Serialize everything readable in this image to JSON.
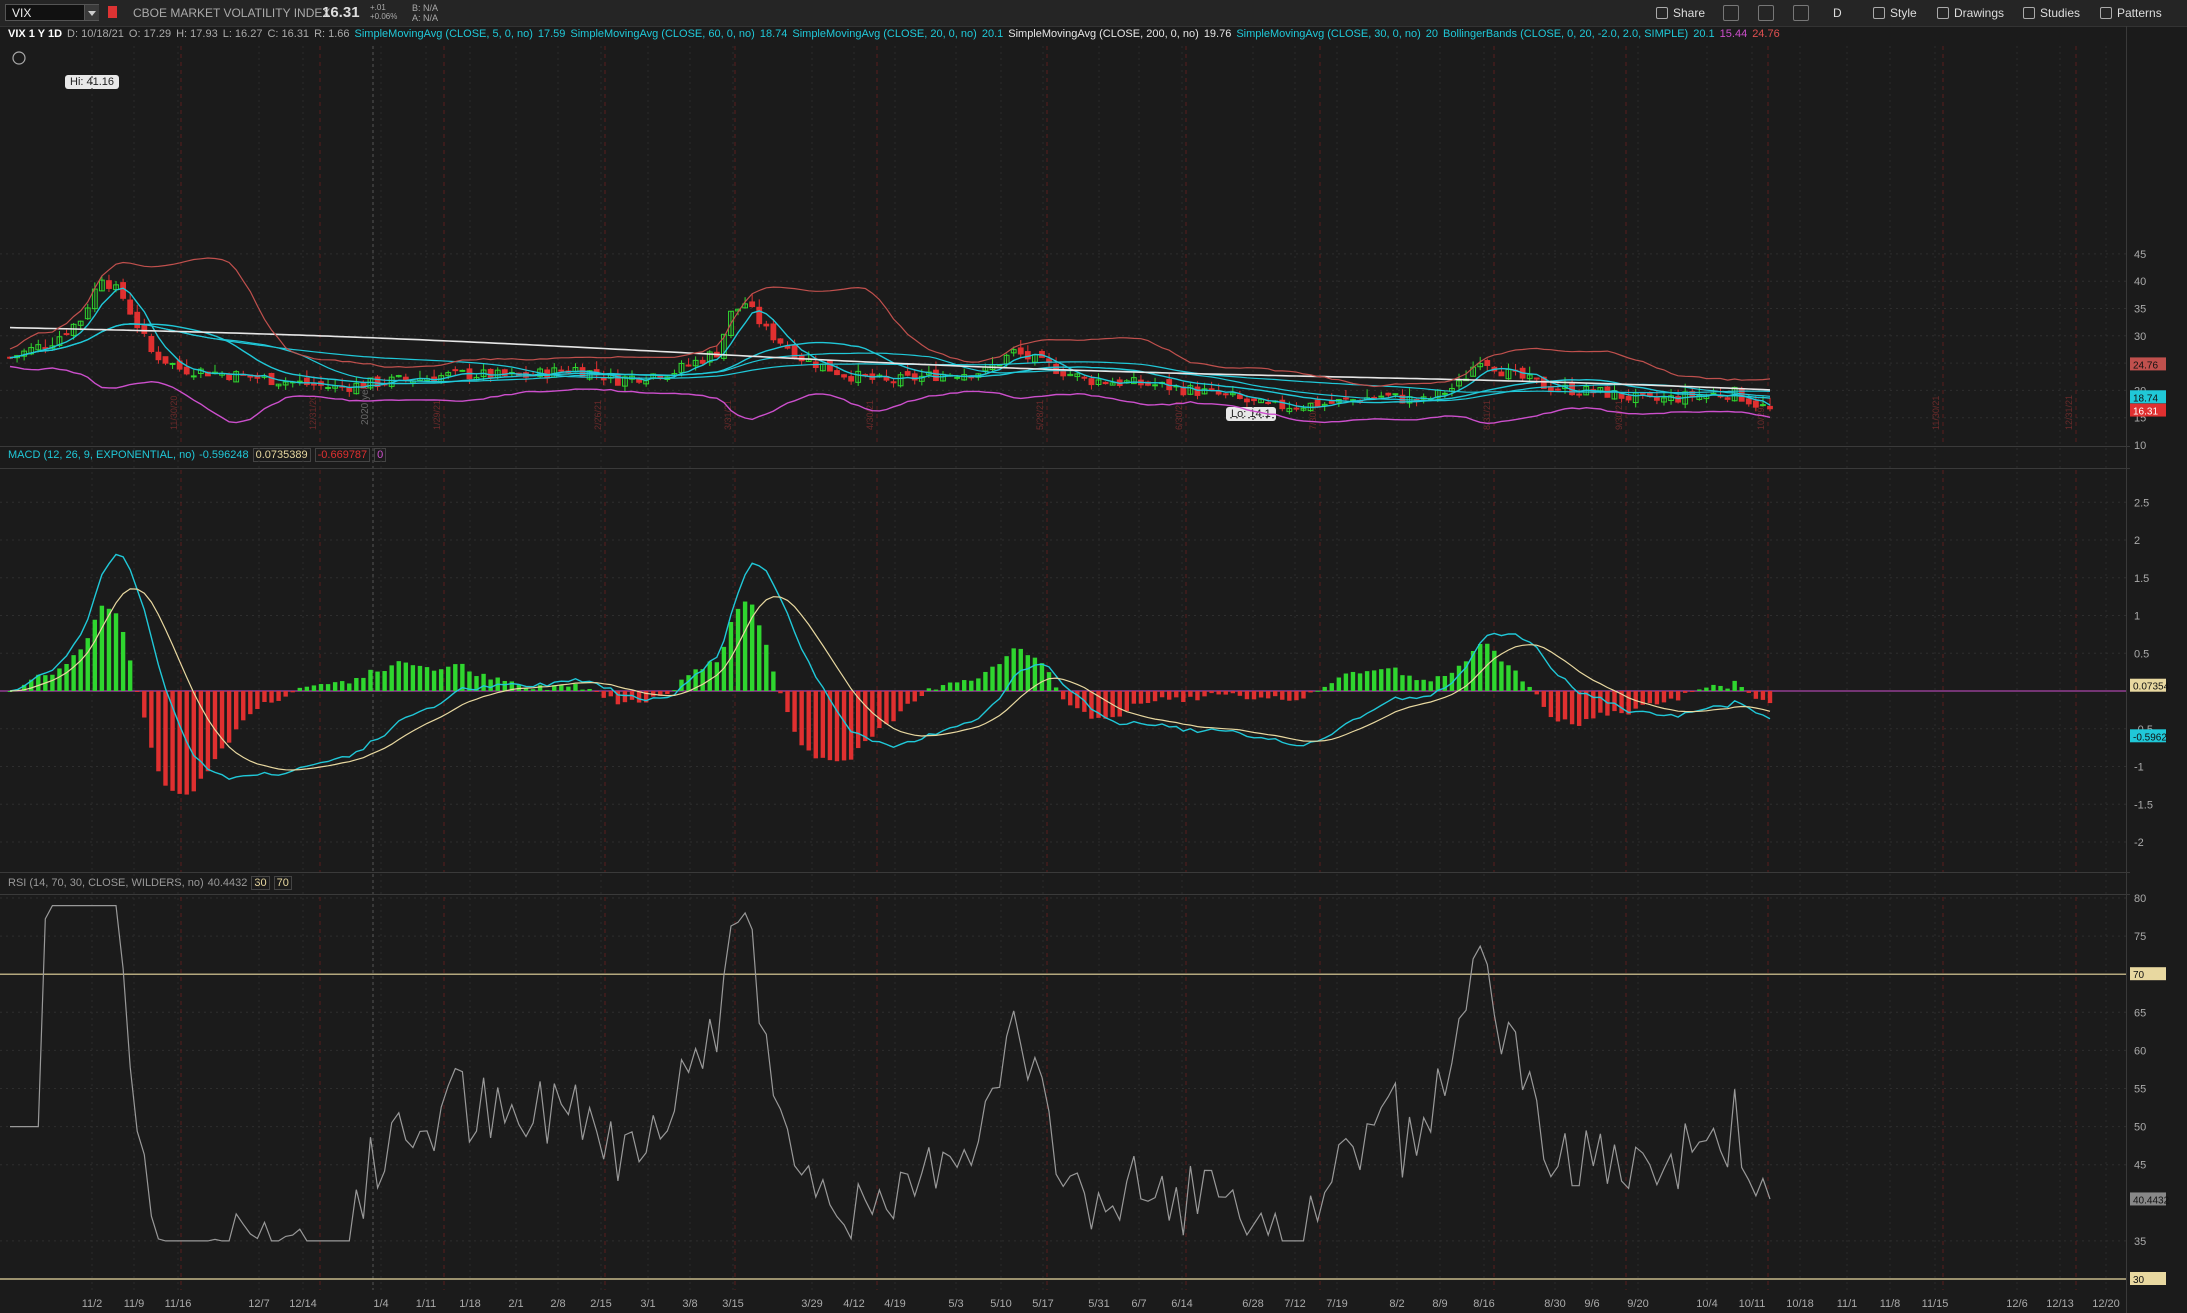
{
  "toolbar": {
    "symbol": "VIX",
    "name": "CBOE MARKET VOLATILITY INDEX",
    "last": "16.31",
    "change": "+.01",
    "change_pct": "+0.06%",
    "bid": "B: N/A",
    "ask": "A: N/A",
    "share": "Share",
    "period": "D",
    "style": "Style",
    "drawings": "Drawings",
    "studies": "Studies",
    "patterns": "Patterns"
  },
  "studybar": {
    "chart_label": "VIX 1 Y 1D",
    "date": "D: 10/18/21",
    "open": "O: 17.29",
    "high": "H: 17.93",
    "low": "L: 16.27",
    "close": "C: 16.31",
    "range": "R: 1.66",
    "sma5": "SimpleMovingAvg (CLOSE, 5, 0, no)",
    "sma5_v": "17.59",
    "sma60": "SimpleMovingAvg (CLOSE, 60, 0, no)",
    "sma60_v": "18.74",
    "sma20": "SimpleMovingAvg (CLOSE, 20, 0, no)",
    "sma20_v": "20.1",
    "sma200": "SimpleMovingAvg (CLOSE, 200, 0, no)",
    "sma200_v": "19.76",
    "sma30": "SimpleMovingAvg (CLOSE, 30, 0, no)",
    "sma30_v": "20",
    "bb": "BollingerBands (CLOSE, 0, 20, -2.0, 2.0, SIMPLE)",
    "bb_mid": "20.1",
    "bb_low": "15.44",
    "bb_up": "24.76"
  },
  "price_pane": {
    "hi_label": "Hi: 41.16",
    "lo_label": "Lo: 14.1",
    "year_label": "2020 year",
    "axis_ticks": [
      "45",
      "40",
      "35",
      "30",
      "25",
      "20",
      "15",
      "10"
    ],
    "tag_up": "24.76",
    "tag_mid": "18.74",
    "tag_last": "16.31",
    "vertical_dates": [
      "11/30/20",
      "12/31/20",
      "1/29/21",
      "2/26/21",
      "3/31/21",
      "4/30/21",
      "5/28/21",
      "6/30/21",
      "7/30/21",
      "8/31/21",
      "9/30/21",
      "10/29/21",
      "11/30/21",
      "12/31/21"
    ]
  },
  "macd_pane": {
    "title": "MACD (12, 26, 9, EXPONENTIAL, no)",
    "value": "-0.596248",
    "avg": "0.0735389",
    "diff": "-0.669787",
    "zero": "0",
    "axis_ticks": [
      "2.5",
      "2",
      "1.5",
      "1",
      "0.5",
      "-0.5",
      "-1",
      "-1.5",
      "-2"
    ],
    "tag_avg": "0.07354",
    "tag_value": "-0.5962"
  },
  "rsi_pane": {
    "title": "RSI (14, 70, 30, CLOSE, WILDERS, no)",
    "value": "40.4432",
    "os": "30",
    "ob": "70",
    "axis_ticks": [
      "80",
      "75",
      "65",
      "60",
      "55",
      "50",
      "45",
      "35"
    ],
    "tag_ob": "70",
    "tag_os": "30",
    "tag_value": "40.4432"
  },
  "x_axis_labels": [
    "11/2",
    "11/9",
    "11/16",
    "12/7",
    "12/14",
    "1/4",
    "1/11",
    "1/18",
    "2/1",
    "2/8",
    "2/15",
    "3/1",
    "3/8",
    "3/15",
    "3/29",
    "4/12",
    "4/19",
    "5/3",
    "5/10",
    "5/17",
    "5/31",
    "6/7",
    "6/14",
    "6/28",
    "7/12",
    "7/19",
    "8/2",
    "8/9",
    "8/16",
    "8/30",
    "9/6",
    "9/20",
    "10/4",
    "10/11",
    "10/18",
    "11/1",
    "11/8",
    "11/15",
    "12/6",
    "12/13",
    "12/20"
  ],
  "colors": {
    "up": "#2fd62f",
    "down": "#e03030",
    "sma_white": "#e6e6e6",
    "sma_cyan": "#20c8d8",
    "bb_upper": "#c0504d",
    "bb_lower": "#cc4fcc",
    "macd_line": "#20c8d8",
    "signal_line": "#e8d8a0",
    "rsi_line": "#999999",
    "level_line": "#e8d8a0"
  }
}
